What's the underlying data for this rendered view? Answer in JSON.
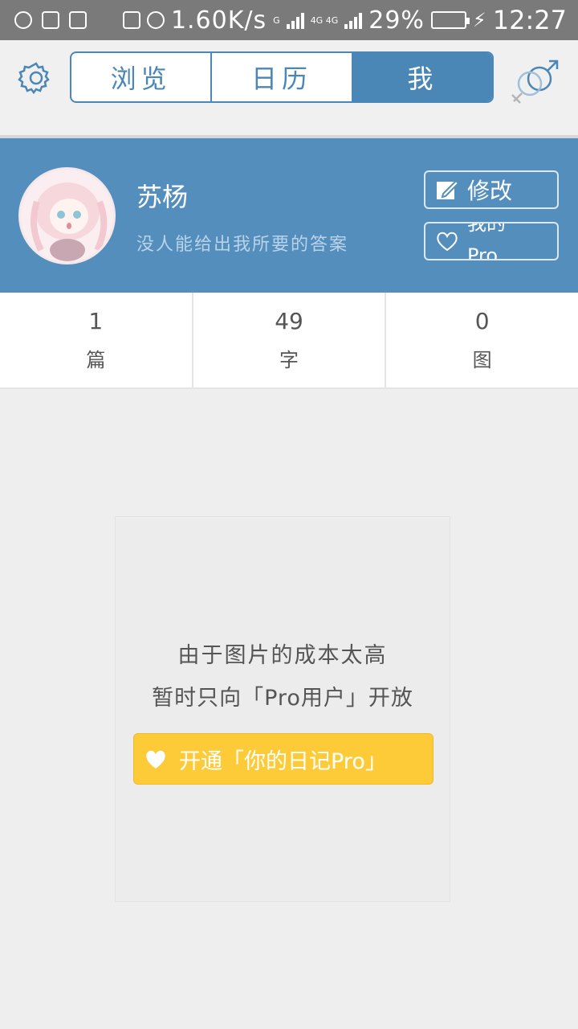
{
  "status_bar": {
    "speed": "1.60K/s",
    "net1": "G",
    "net2": "4G 4G",
    "battery": "29%",
    "time": "12:27"
  },
  "header": {
    "tabs": [
      {
        "label": "浏览",
        "active": false
      },
      {
        "label": "日历",
        "active": false
      },
      {
        "label": "我",
        "active": true
      }
    ],
    "icons": {
      "settings": "gear-icon",
      "gender": "gender-icon"
    }
  },
  "profile": {
    "name": "苏杨",
    "bio": "没人能给出我所要的答案",
    "edit_label": "修改",
    "pro_label": "我的Pro"
  },
  "stats": [
    {
      "value": "1",
      "label": "篇"
    },
    {
      "value": "49",
      "label": "字"
    },
    {
      "value": "0",
      "label": "图"
    }
  ],
  "content": {
    "line1": "由于图片的成本太高",
    "line2": "暂时只向「Pro用户」开放",
    "button_label": "开通「你的日记Pro」"
  },
  "colors": {
    "accent": "#4a86b6",
    "profile_bg": "#548ebd",
    "pro_button": "#fdcb37"
  }
}
